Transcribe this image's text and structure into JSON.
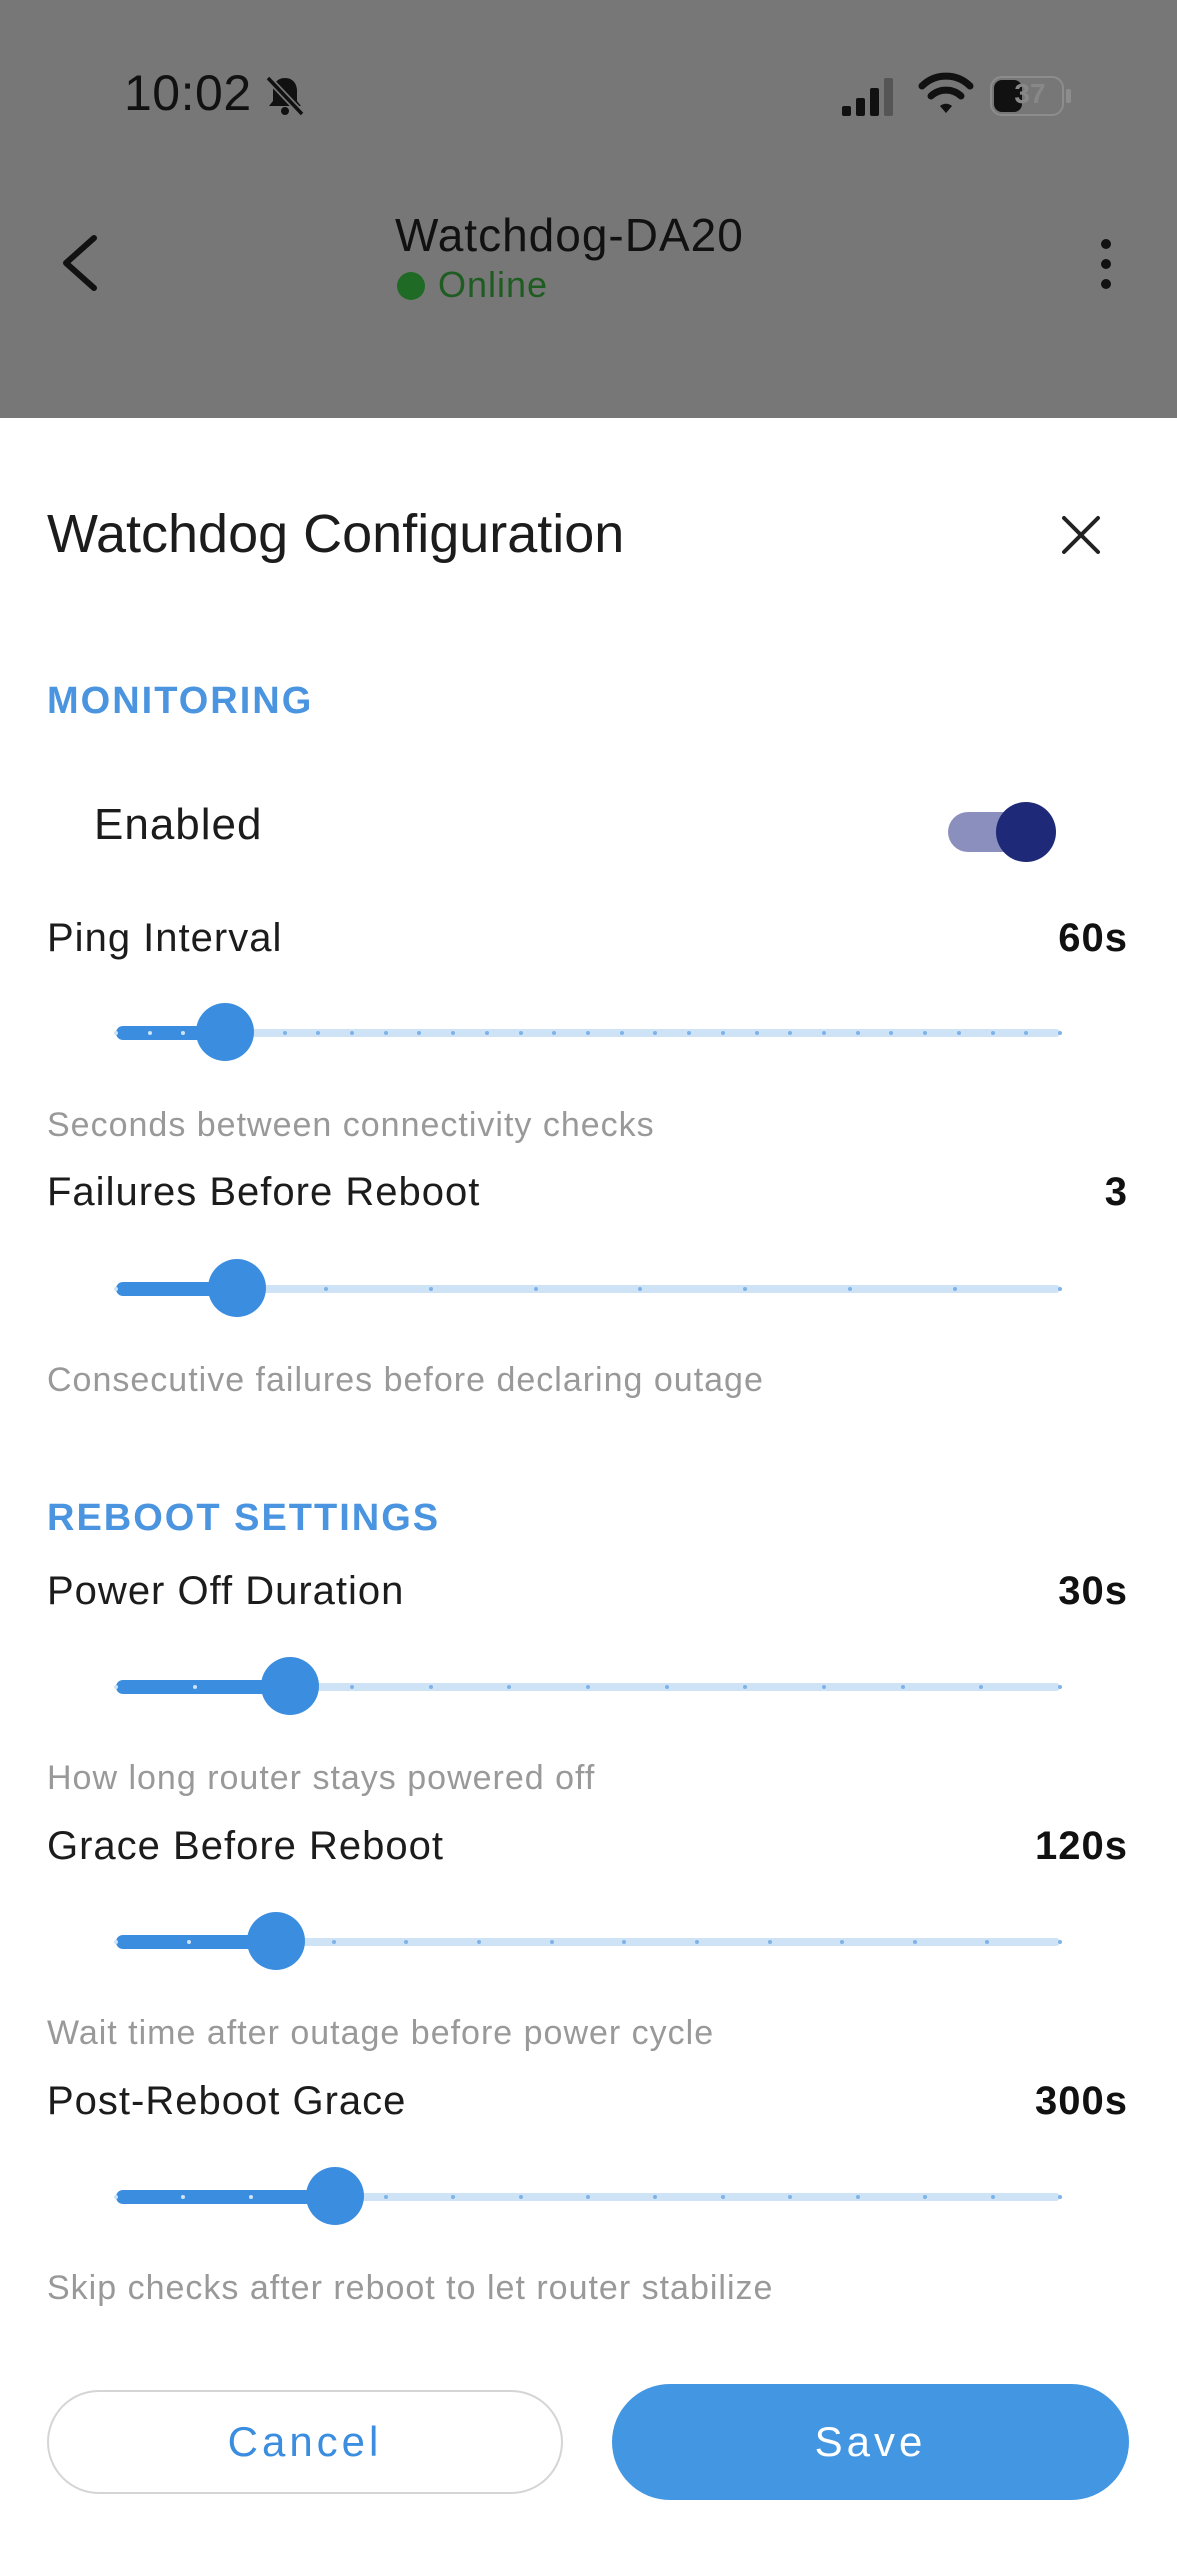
{
  "status_bar": {
    "time": "10:02",
    "battery": "37"
  },
  "header": {
    "device_name": "Watchdog-DA20",
    "status": "Online"
  },
  "sheet": {
    "title": "Watchdog Configuration",
    "monitoring": {
      "heading": "MONITORING",
      "enabled_label": "Enabled",
      "enabled": true,
      "ping_interval": {
        "label": "Ping Interval",
        "value": "60s",
        "helper": "Seconds between connectivity checks",
        "fraction": 0.115
      },
      "failures": {
        "label": "Failures Before Reboot",
        "value": "3",
        "helper": "Consecutive failures before declaring outage",
        "fraction": 0.128
      }
    },
    "reboot": {
      "heading": "REBOOT SETTINGS",
      "power_off": {
        "label": "Power Off Duration",
        "value": "30s",
        "helper": "How long router stays powered off",
        "fraction": 0.184
      },
      "grace_before": {
        "label": "Grace Before Reboot",
        "value": "120s",
        "helper": "Wait time after outage before power cycle",
        "fraction": 0.17
      },
      "post_reboot": {
        "label": "Post-Reboot Grace",
        "value": "300s",
        "helper": "Skip checks after reboot to let router stabilize",
        "fraction": 0.232
      }
    }
  },
  "actions": {
    "cancel_label": "Cancel",
    "save_label": "Save"
  },
  "colors": {
    "accent": "#4296e2",
    "toggle_on": "#1e2a78",
    "online": "#1f6b25"
  }
}
